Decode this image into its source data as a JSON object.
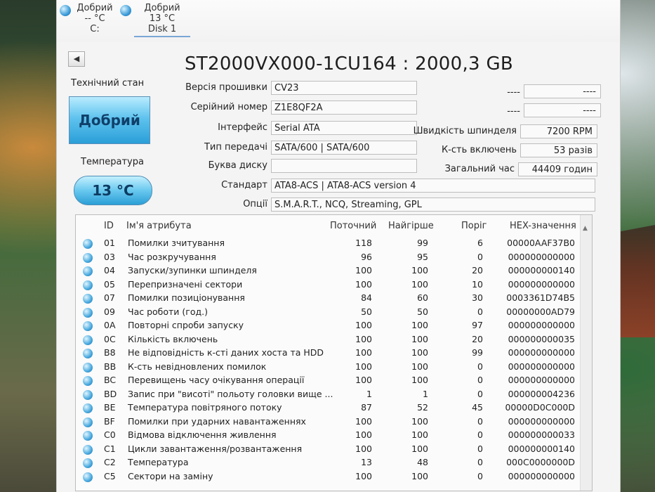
{
  "disks": [
    {
      "status": "Добрий",
      "temp": "-- °C",
      "name": "C:"
    },
    {
      "status": "Добрий",
      "temp": "13 °C",
      "name": "Disk 1"
    }
  ],
  "model": "ST2000VX000-1CU164 : 2000,3 GB",
  "health": {
    "label": "Технічний стан",
    "value": "Добрий"
  },
  "temperature": {
    "label": "Температура",
    "value": "13 °C"
  },
  "info": {
    "firmware": {
      "label": "Версія прошивки",
      "value": "CV23"
    },
    "serial": {
      "label": "Серійний номер",
      "value": "Z1E8QF2A"
    },
    "interface": {
      "label": "Інтерфейс",
      "value": "Serial ATA"
    },
    "transfer": {
      "label": "Тип передачі",
      "value": "SATA/600 | SATA/600"
    },
    "letter": {
      "label": "Буква диску",
      "value": ""
    },
    "standard": {
      "label": "Стандарт",
      "value": "ATA8-ACS | ATA8-ACS version 4"
    },
    "features": {
      "label": "Опції",
      "value": "S.M.A.R.T., NCQ, Streaming, GPL"
    }
  },
  "right": {
    "r1": {
      "label": "----",
      "value": "----"
    },
    "r2": {
      "label": "----",
      "value": "----"
    },
    "rpm": {
      "label": "Швидкість шпинделя",
      "value": "7200 RPM"
    },
    "power_count": {
      "label": "К-сть включень",
      "value": "53 разів"
    },
    "hours": {
      "label": "Загальний час",
      "value": "44409 годин"
    }
  },
  "table": {
    "headers": {
      "id": "ID",
      "name": "Ім'я атрибута",
      "current": "Поточний",
      "worst": "Найгірше",
      "threshold": "Поріг",
      "raw": "HEX-значення"
    },
    "rows": [
      {
        "id": "01",
        "name": "Помилки зчитування",
        "current": "118",
        "worst": "99",
        "threshold": "6",
        "raw": "00000AAF37B0"
      },
      {
        "id": "03",
        "name": "Час розкручування",
        "current": "96",
        "worst": "95",
        "threshold": "0",
        "raw": "000000000000"
      },
      {
        "id": "04",
        "name": "Запуски/зупинки шпинделя",
        "current": "100",
        "worst": "100",
        "threshold": "20",
        "raw": "000000000140"
      },
      {
        "id": "05",
        "name": "Перепризначені сектори",
        "current": "100",
        "worst": "100",
        "threshold": "10",
        "raw": "000000000000"
      },
      {
        "id": "07",
        "name": "Помилки позиціонування",
        "current": "84",
        "worst": "60",
        "threshold": "30",
        "raw": "0003361D74B5"
      },
      {
        "id": "09",
        "name": "Час роботи (год.)",
        "current": "50",
        "worst": "50",
        "threshold": "0",
        "raw": "00000000AD79"
      },
      {
        "id": "0A",
        "name": "Повторні спроби запуску",
        "current": "100",
        "worst": "100",
        "threshold": "97",
        "raw": "000000000000"
      },
      {
        "id": "0C",
        "name": "Кількість включень",
        "current": "100",
        "worst": "100",
        "threshold": "20",
        "raw": "000000000035"
      },
      {
        "id": "B8",
        "name": "Не відповідність к-сті даних хоста та HDD",
        "current": "100",
        "worst": "100",
        "threshold": "99",
        "raw": "000000000000"
      },
      {
        "id": "BB",
        "name": "К-сть невідновлених помилок",
        "current": "100",
        "worst": "100",
        "threshold": "0",
        "raw": "000000000000"
      },
      {
        "id": "BC",
        "name": "Перевищень часу очікування операції",
        "current": "100",
        "worst": "100",
        "threshold": "0",
        "raw": "000000000000"
      },
      {
        "id": "BD",
        "name": "Запис при \"висоті\" польоту головки вище ...",
        "current": "1",
        "worst": "1",
        "threshold": "0",
        "raw": "000000004236"
      },
      {
        "id": "BE",
        "name": "Температура повітряного потоку",
        "current": "87",
        "worst": "52",
        "threshold": "45",
        "raw": "00000D0C000D"
      },
      {
        "id": "BF",
        "name": "Помилки при ударних навантаженнях",
        "current": "100",
        "worst": "100",
        "threshold": "0",
        "raw": "000000000000"
      },
      {
        "id": "C0",
        "name": "Відмова відключення живлення",
        "current": "100",
        "worst": "100",
        "threshold": "0",
        "raw": "000000000033"
      },
      {
        "id": "C1",
        "name": "Цикли завантаження/розвантаження",
        "current": "100",
        "worst": "100",
        "threshold": "0",
        "raw": "000000000140"
      },
      {
        "id": "C2",
        "name": "Температура",
        "current": "13",
        "worst": "48",
        "threshold": "0",
        "raw": "000C0000000D"
      },
      {
        "id": "C5",
        "name": "Сектори на заміну",
        "current": "100",
        "worst": "100",
        "threshold": "0",
        "raw": "000000000000"
      }
    ]
  }
}
